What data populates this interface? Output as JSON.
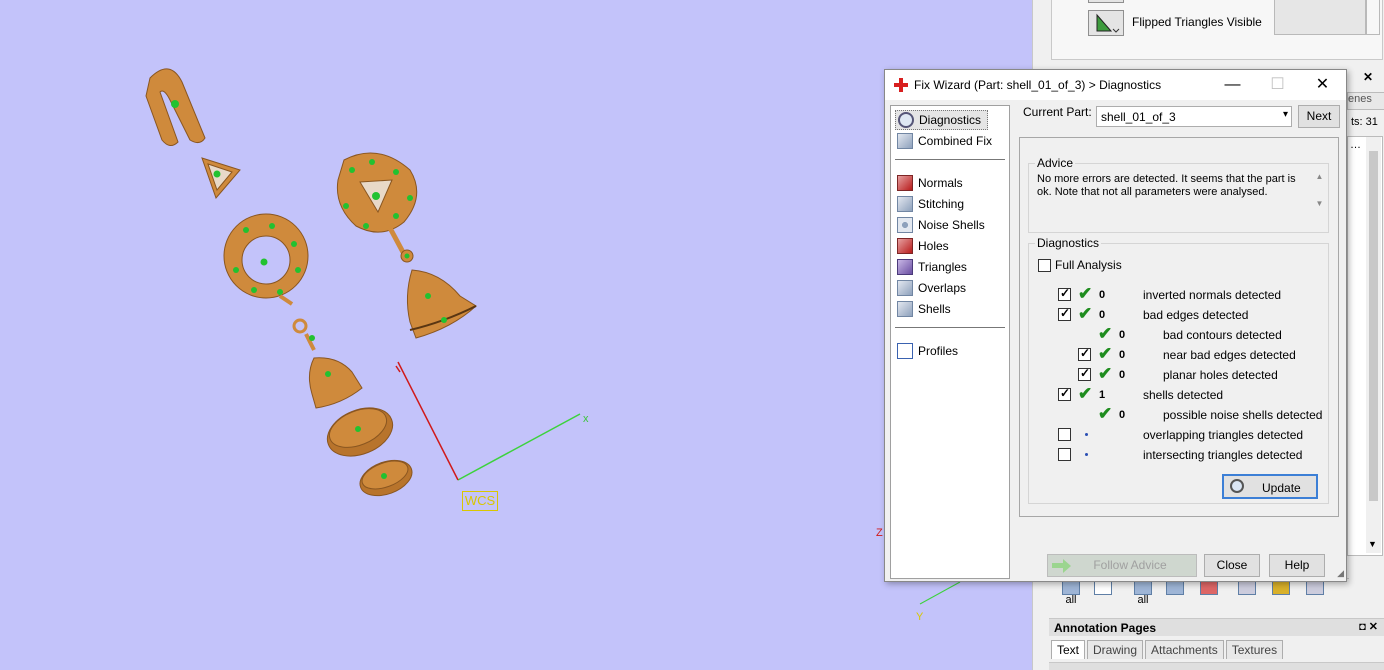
{
  "dialog": {
    "title": "Fix Wizard (Part: shell_01_of_3) > Diagnostics",
    "current_part_label": "Current Part:",
    "current_part_value": "shell_01_of_3",
    "next_label": "Next",
    "advice_heading": "Advice",
    "advice_text": "No more errors are detected. It seems that the part is ok. Note that not all parameters were analysed.",
    "diagnostics_heading": "Diagnostics",
    "full_analysis_label": "Full Analysis",
    "full_analysis_checked": false,
    "update_label": "Update",
    "follow_advice_label": "Follow Advice",
    "close_label": "Close",
    "help_label": "Help"
  },
  "nav": {
    "top": [
      {
        "label": "Diagnostics",
        "icon": "magnifier-icon",
        "selected": true
      },
      {
        "label": "Combined Fix",
        "icon": "cube-icon"
      }
    ],
    "middle": [
      {
        "label": "Normals",
        "icon": "normals-cube-icon"
      },
      {
        "label": "Stitching",
        "icon": "stitching-cube-icon"
      },
      {
        "label": "Noise Shells",
        "icon": "noise-shells-icon"
      },
      {
        "label": "Holes",
        "icon": "holes-cube-icon"
      },
      {
        "label": "Triangles",
        "icon": "triangles-cube-icon"
      },
      {
        "label": "Overlaps",
        "icon": "overlaps-cube-icon"
      },
      {
        "label": "Shells",
        "icon": "shells-cube-icon"
      }
    ],
    "bottom": [
      {
        "label": "Profiles",
        "icon": "profiles-document-icon"
      }
    ]
  },
  "diagnostics": [
    {
      "checkbox": true,
      "checked": true,
      "status": "ok",
      "count": "0",
      "label": "inverted normals detected",
      "indent": 0
    },
    {
      "checkbox": true,
      "checked": true,
      "status": "ok",
      "count": "0",
      "label": "bad edges detected",
      "indent": 0
    },
    {
      "checkbox": false,
      "checked": false,
      "status": "ok",
      "count": "0",
      "label": "bad contours detected",
      "indent": 1
    },
    {
      "checkbox": true,
      "checked": true,
      "status": "ok",
      "count": "0",
      "label": "near bad edges detected",
      "indent": 1
    },
    {
      "checkbox": true,
      "checked": true,
      "status": "ok",
      "count": "0",
      "label": "planar holes detected",
      "indent": 1
    },
    {
      "checkbox": true,
      "checked": true,
      "status": "ok",
      "count": "1",
      "label": "shells detected",
      "indent": 0
    },
    {
      "checkbox": false,
      "checked": false,
      "status": "ok",
      "count": "0",
      "label": "possible noise shells detected",
      "indent": 1
    },
    {
      "checkbox": true,
      "checked": false,
      "status": "dot",
      "count": "",
      "label": "overlapping triangles detected",
      "indent": 0
    },
    {
      "checkbox": true,
      "checked": false,
      "status": "dot",
      "count": "",
      "label": "intersecting triangles detected",
      "indent": 0
    }
  ],
  "viewport": {
    "wcs_label": "WCS",
    "x_axis_label": "x",
    "background": "#c3c3fa",
    "model_color": "#cf8a3c",
    "marker_color": "#22c230"
  },
  "right_panel": {
    "flipped_label": "Flipped Triangles Visible",
    "partial_tab": "enes",
    "partial_count": "ts: 31",
    "annotation_header": "Annotation Pages",
    "tabs": [
      "Text",
      "Drawing",
      "Attachments",
      "Textures"
    ],
    "toolbar_all_1": "all",
    "toolbar_all_2": "all"
  }
}
